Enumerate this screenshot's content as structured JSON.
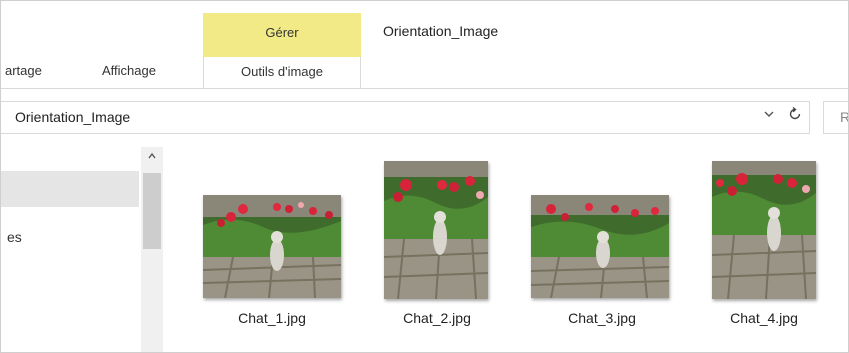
{
  "ribbon": {
    "tabs": [
      "artage",
      "Affichage"
    ],
    "context_group_label": "Gérer",
    "context_tab_label": "Outils d'image",
    "context_color": "#f1ea86"
  },
  "window": {
    "title": "Orientation_Image"
  },
  "address": {
    "path": "Orientation_Image",
    "dropdown_icon": "chevron-down-icon",
    "refresh_icon": "refresh-icon"
  },
  "search": {
    "placeholder": "R"
  },
  "nav": {
    "items": [
      {
        "label": ""
      },
      {
        "label": "es"
      }
    ]
  },
  "files": [
    {
      "name": "Chat_1.jpg",
      "orientation": "landscape"
    },
    {
      "name": "Chat_2.jpg",
      "orientation": "portrait"
    },
    {
      "name": "Chat_3.jpg",
      "orientation": "landscape"
    },
    {
      "name": "Chat_4.jpg",
      "orientation": "portrait"
    }
  ]
}
